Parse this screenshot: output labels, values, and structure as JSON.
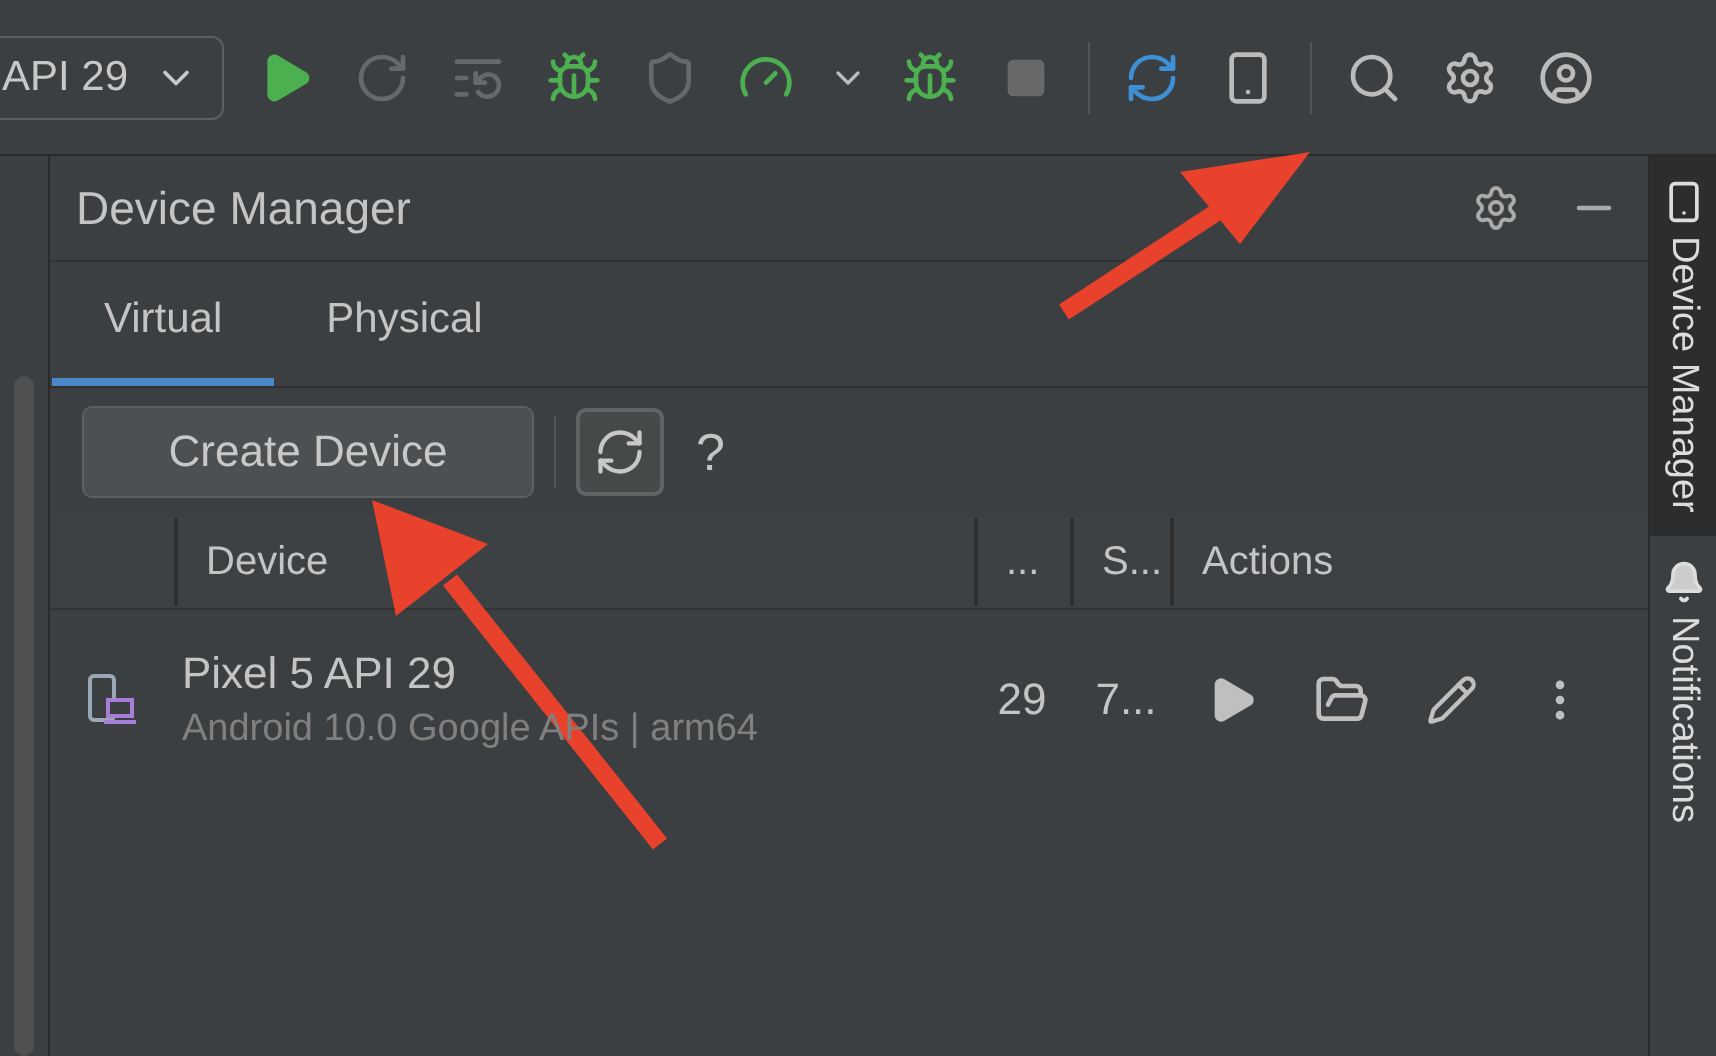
{
  "toolbar": {
    "device_selector": "API 29",
    "buttons": [
      {
        "disabled": false
      },
      {
        "disabled": true
      },
      {
        "disabled": true
      },
      {
        "disabled": false
      },
      {
        "disabled": true
      },
      {
        "disabled": false
      },
      {
        "disabled": false
      },
      {
        "disabled": true
      },
      {
        "disabled": false
      },
      {
        "disabled": false
      },
      {
        "disabled": false
      },
      {
        "disabled": false
      },
      {
        "disabled": false
      }
    ]
  },
  "panel": {
    "title": "Device Manager",
    "tabs": [
      {
        "label": "Virtual",
        "selected": true
      },
      {
        "label": "Physical",
        "selected": false
      }
    ],
    "create_button": "Create Device",
    "help": "?",
    "table": {
      "columns": [
        "Device",
        "...",
        "S...",
        "Actions"
      ],
      "rows": [
        {
          "name": "Pixel 5 API 29",
          "details": "Android 10.0 Google APIs | arm64",
          "api": "29",
          "column_3": "7..."
        }
      ]
    }
  },
  "side_tabs": [
    {
      "label": "Device Manager",
      "selected": true
    },
    {
      "label": "Notifications",
      "selected": false
    }
  ]
}
